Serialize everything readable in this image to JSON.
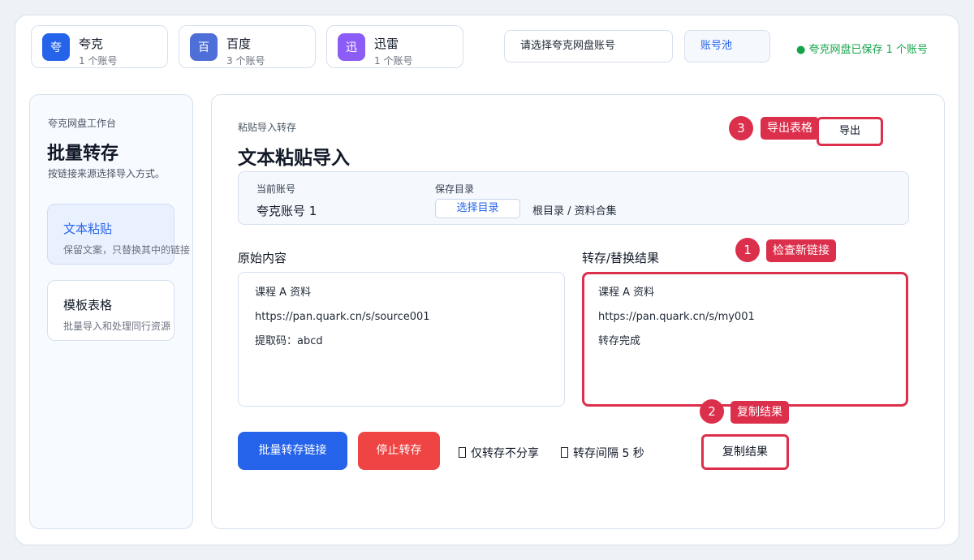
{
  "accounts": [
    {
      "icon_text": "夸",
      "name": "夸克",
      "count": "1 个账号",
      "color": "#2563eb"
    },
    {
      "icon_text": "百",
      "name": "百度",
      "count": "3 个账号",
      "color": "#4f6fd8"
    },
    {
      "icon_text": "迅",
      "name": "迅雷",
      "count": "1 个账号",
      "color": "#8b5cf6"
    }
  ],
  "header": {
    "account_select": "请选择夸克网盘账号",
    "pool_button": "账号池",
    "saved_status": "● 夸克网盘已保存 1 个账号"
  },
  "sidebar": {
    "caption": "夸克网盘工作台",
    "title": "批量转存",
    "desc": "按链接来源选择导入方式。",
    "items": [
      {
        "title": "文本粘贴",
        "desc": "保留文案，只替换其中的链接"
      },
      {
        "title": "模板表格",
        "desc": "批量导入和处理同行资源"
      }
    ]
  },
  "main": {
    "caption": "粘贴导入转存",
    "title": "文本粘贴导入",
    "export_button": "导出",
    "current_account_label": "当前账号",
    "current_account_value": "夸克账号 1",
    "save_dir_label": "保存目录",
    "select_dir_button": "选择目录",
    "dir_path": "根目录 / 资料合集",
    "original_label": "原始内容",
    "original_lines": [
      "课程 A 资料",
      "https://pan.quark.cn/s/source001",
      "提取码：abcd"
    ],
    "result_label": "转存/替换结果",
    "result_lines": [
      "课程 A 资料",
      "https://pan.quark.cn/s/my001",
      "转存完成"
    ],
    "batch_button": "批量转存链接",
    "stop_button": "停止转存",
    "option_no_share": "仅转存不分享",
    "option_interval": "转存间隔 5 秒",
    "copy_button": "复制结果"
  },
  "callouts": [
    {
      "number": "1",
      "label": "检查新链接"
    },
    {
      "number": "2",
      "label": "复制结果"
    },
    {
      "number": "3",
      "label": "导出表格"
    }
  ],
  "colors": {
    "primary": "#2563eb",
    "danger": "#ef4444",
    "callout": "#dc2f4c",
    "success": "#16a34a"
  }
}
